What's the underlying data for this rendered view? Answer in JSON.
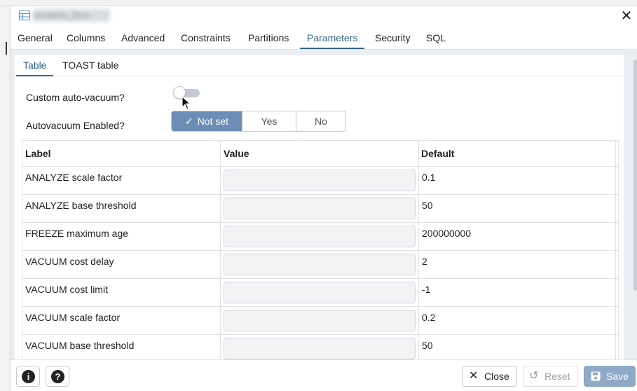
{
  "dialog": {
    "title": "conams_boo"
  },
  "tabs": [
    {
      "label": "General"
    },
    {
      "label": "Columns"
    },
    {
      "label": "Advanced"
    },
    {
      "label": "Constraints"
    },
    {
      "label": "Partitions"
    },
    {
      "label": "Parameters"
    },
    {
      "label": "Security"
    },
    {
      "label": "SQL"
    }
  ],
  "active_tab": "Parameters",
  "subtabs": [
    {
      "label": "Table"
    },
    {
      "label": "TOAST table"
    }
  ],
  "form": {
    "custom_autovacuum_label": "Custom auto-vacuum?",
    "custom_autovacuum_on": false,
    "autovacuum_enabled_label": "Autovacuum Enabled?",
    "autovacuum_options": [
      "Not set",
      "Yes",
      "No"
    ],
    "autovacuum_selected": "Not set"
  },
  "grid": {
    "headers": [
      "Label",
      "Value",
      "Default"
    ],
    "rows": [
      {
        "label": "ANALYZE scale factor",
        "value": "",
        "default": "0.1"
      },
      {
        "label": "ANALYZE base threshold",
        "value": "",
        "default": "50"
      },
      {
        "label": "FREEZE maximum age",
        "value": "",
        "default": "200000000"
      },
      {
        "label": "VACUUM cost delay",
        "value": "",
        "default": "2"
      },
      {
        "label": "VACUUM cost limit",
        "value": "",
        "default": "-1"
      },
      {
        "label": "VACUUM scale factor",
        "value": "",
        "default": "0.2"
      },
      {
        "label": "VACUUM base threshold",
        "value": "",
        "default": "50"
      }
    ]
  },
  "footer": {
    "info_icon": "i",
    "help_icon": "?",
    "close_label": "Close",
    "reset_label": "Reset",
    "save_label": "Save"
  },
  "colors": {
    "accent": "#326690",
    "toggle_active": "#6c8db5",
    "save_button": "#8fa9c6"
  }
}
